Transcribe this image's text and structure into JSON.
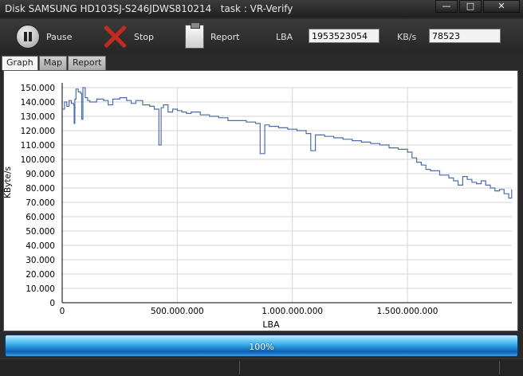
{
  "window": {
    "title": "Disk SAMSUNG HD103SJ-S246JDWS810214   task : VR-Verify",
    "controls": [
      "minimize-icon",
      "maximize-icon",
      "close-icon"
    ]
  },
  "toolbar": {
    "pause_label": "Pause",
    "stop_label": "Stop",
    "report_label": "Report",
    "lba_label": "LBA",
    "lba_value": "1953523054",
    "kbs_label": "KB/s",
    "kbs_value": "78523"
  },
  "tabs": [
    {
      "label": "Graph",
      "active": true
    },
    {
      "label": "Map",
      "active": false
    },
    {
      "label": "Report",
      "active": false
    }
  ],
  "progress": {
    "label": "100%",
    "value": 1.0
  },
  "chart_data": {
    "type": "line",
    "xlabel": "LBA",
    "ylabel": "KByte/s",
    "xlim": [
      0,
      1953525168
    ],
    "ylim": [
      0,
      150000
    ],
    "x_ticks": [
      {
        "v": 0,
        "label": "0"
      },
      {
        "v": 500000000,
        "label": "500.000.000"
      },
      {
        "v": 1000000000,
        "label": "1.000.000.000"
      },
      {
        "v": 1500000000,
        "label": "1.500.000.000"
      }
    ],
    "y_ticks": [
      {
        "v": 0,
        "label": "0"
      },
      {
        "v": 10000,
        "label": "10.000"
      },
      {
        "v": 20000,
        "label": "20.000"
      },
      {
        "v": 30000,
        "label": "30.000"
      },
      {
        "v": 40000,
        "label": "40.000"
      },
      {
        "v": 50000,
        "label": "50.000"
      },
      {
        "v": 60000,
        "label": "60.000"
      },
      {
        "v": 70000,
        "label": "70.000"
      },
      {
        "v": 80000,
        "label": "80.000"
      },
      {
        "v": 90000,
        "label": "90.000"
      },
      {
        "v": 100000,
        "label": "100.000"
      },
      {
        "v": 110000,
        "label": "110.000"
      },
      {
        "v": 120000,
        "label": "120.000"
      },
      {
        "v": 130000,
        "label": "130.000"
      },
      {
        "v": 140000,
        "label": "140.000"
      },
      {
        "v": 150000,
        "label": "150.000"
      }
    ],
    "grid": true,
    "series": [
      {
        "color": "#4a6ea8",
        "x": [
          0,
          10000000,
          20000000,
          30000000,
          40000000,
          50000000,
          52000000,
          55000000,
          60000000,
          70000000,
          80000000,
          85000000,
          90000000,
          100000000,
          110000000,
          120000000,
          150000000,
          180000000,
          200000000,
          220000000,
          250000000,
          280000000,
          300000000,
          320000000,
          350000000,
          380000000,
          400000000,
          420000000,
          430000000,
          440000000,
          460000000,
          480000000,
          500000000,
          520000000,
          540000000,
          560000000,
          600000000,
          640000000,
          680000000,
          720000000,
          760000000,
          800000000,
          840000000,
          860000000,
          880000000,
          900000000,
          940000000,
          980000000,
          1020000000,
          1060000000,
          1080000000,
          1100000000,
          1140000000,
          1180000000,
          1220000000,
          1260000000,
          1300000000,
          1340000000,
          1380000000,
          1420000000,
          1460000000,
          1500000000,
          1520000000,
          1540000000,
          1560000000,
          1580000000,
          1600000000,
          1640000000,
          1680000000,
          1700000000,
          1720000000,
          1740000000,
          1760000000,
          1780000000,
          1800000000,
          1820000000,
          1840000000,
          1860000000,
          1880000000,
          1900000000,
          1920000000,
          1940000000,
          1953000000
        ],
        "values": [
          135000,
          140000,
          137000,
          141000,
          139000,
          138000,
          125000,
          142000,
          149000,
          147000,
          146000,
          128000,
          150000,
          143000,
          141000,
          140000,
          142000,
          141000,
          138000,
          142000,
          143000,
          141000,
          139000,
          141000,
          138000,
          137000,
          135000,
          110000,
          136000,
          138000,
          133000,
          135000,
          134000,
          133000,
          132000,
          133000,
          131000,
          130000,
          129000,
          127000,
          127000,
          126000,
          125000,
          104000,
          124000,
          123000,
          122000,
          121000,
          120000,
          118000,
          106000,
          117000,
          116000,
          115000,
          114000,
          113000,
          112000,
          111000,
          110000,
          108000,
          107000,
          105000,
          101000,
          98000,
          96000,
          93000,
          92000,
          89000,
          87000,
          85000,
          82000,
          88000,
          86000,
          84000,
          83000,
          85000,
          82000,
          80000,
          78000,
          79000,
          76000,
          73000,
          79000
        ]
      }
    ]
  }
}
